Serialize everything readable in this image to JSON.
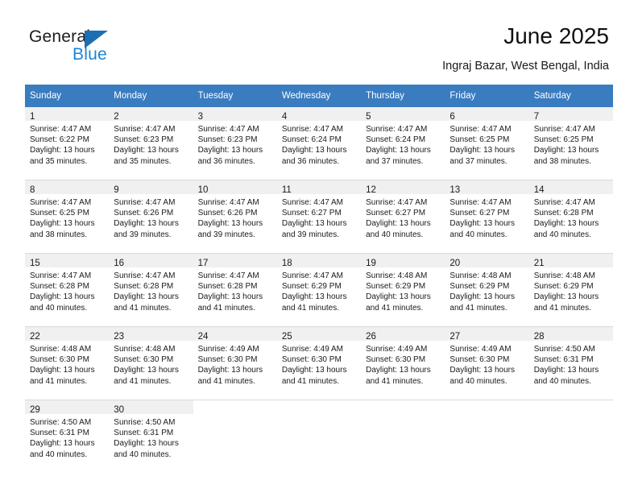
{
  "brand": {
    "name_part1": "General",
    "name_part2": "Blue",
    "flag_icon": "triangle-flag-icon"
  },
  "header": {
    "title": "June 2025",
    "location": "Ingraj Bazar, West Bengal, India"
  },
  "colors": {
    "header_blue": "#3a7cc0",
    "brand_blue": "#1c84d6",
    "daynum_band": "#f0f0f0",
    "row_divider": "#d9d9d9"
  },
  "weekdays": [
    "Sunday",
    "Monday",
    "Tuesday",
    "Wednesday",
    "Thursday",
    "Friday",
    "Saturday"
  ],
  "labels": {
    "sunrise_prefix": "Sunrise:",
    "sunset_prefix": "Sunset:",
    "daylight_prefix": "Daylight:"
  },
  "weeks": [
    [
      {
        "day": "1",
        "sunrise": "Sunrise: 4:47 AM",
        "sunset": "Sunset: 6:22 PM",
        "daylight1": "Daylight: 13 hours",
        "daylight2": "and 35 minutes."
      },
      {
        "day": "2",
        "sunrise": "Sunrise: 4:47 AM",
        "sunset": "Sunset: 6:23 PM",
        "daylight1": "Daylight: 13 hours",
        "daylight2": "and 35 minutes."
      },
      {
        "day": "3",
        "sunrise": "Sunrise: 4:47 AM",
        "sunset": "Sunset: 6:23 PM",
        "daylight1": "Daylight: 13 hours",
        "daylight2": "and 36 minutes."
      },
      {
        "day": "4",
        "sunrise": "Sunrise: 4:47 AM",
        "sunset": "Sunset: 6:24 PM",
        "daylight1": "Daylight: 13 hours",
        "daylight2": "and 36 minutes."
      },
      {
        "day": "5",
        "sunrise": "Sunrise: 4:47 AM",
        "sunset": "Sunset: 6:24 PM",
        "daylight1": "Daylight: 13 hours",
        "daylight2": "and 37 minutes."
      },
      {
        "day": "6",
        "sunrise": "Sunrise: 4:47 AM",
        "sunset": "Sunset: 6:25 PM",
        "daylight1": "Daylight: 13 hours",
        "daylight2": "and 37 minutes."
      },
      {
        "day": "7",
        "sunrise": "Sunrise: 4:47 AM",
        "sunset": "Sunset: 6:25 PM",
        "daylight1": "Daylight: 13 hours",
        "daylight2": "and 38 minutes."
      }
    ],
    [
      {
        "day": "8",
        "sunrise": "Sunrise: 4:47 AM",
        "sunset": "Sunset: 6:25 PM",
        "daylight1": "Daylight: 13 hours",
        "daylight2": "and 38 minutes."
      },
      {
        "day": "9",
        "sunrise": "Sunrise: 4:47 AM",
        "sunset": "Sunset: 6:26 PM",
        "daylight1": "Daylight: 13 hours",
        "daylight2": "and 39 minutes."
      },
      {
        "day": "10",
        "sunrise": "Sunrise: 4:47 AM",
        "sunset": "Sunset: 6:26 PM",
        "daylight1": "Daylight: 13 hours",
        "daylight2": "and 39 minutes."
      },
      {
        "day": "11",
        "sunrise": "Sunrise: 4:47 AM",
        "sunset": "Sunset: 6:27 PM",
        "daylight1": "Daylight: 13 hours",
        "daylight2": "and 39 minutes."
      },
      {
        "day": "12",
        "sunrise": "Sunrise: 4:47 AM",
        "sunset": "Sunset: 6:27 PM",
        "daylight1": "Daylight: 13 hours",
        "daylight2": "and 40 minutes."
      },
      {
        "day": "13",
        "sunrise": "Sunrise: 4:47 AM",
        "sunset": "Sunset: 6:27 PM",
        "daylight1": "Daylight: 13 hours",
        "daylight2": "and 40 minutes."
      },
      {
        "day": "14",
        "sunrise": "Sunrise: 4:47 AM",
        "sunset": "Sunset: 6:28 PM",
        "daylight1": "Daylight: 13 hours",
        "daylight2": "and 40 minutes."
      }
    ],
    [
      {
        "day": "15",
        "sunrise": "Sunrise: 4:47 AM",
        "sunset": "Sunset: 6:28 PM",
        "daylight1": "Daylight: 13 hours",
        "daylight2": "and 40 minutes."
      },
      {
        "day": "16",
        "sunrise": "Sunrise: 4:47 AM",
        "sunset": "Sunset: 6:28 PM",
        "daylight1": "Daylight: 13 hours",
        "daylight2": "and 41 minutes."
      },
      {
        "day": "17",
        "sunrise": "Sunrise: 4:47 AM",
        "sunset": "Sunset: 6:28 PM",
        "daylight1": "Daylight: 13 hours",
        "daylight2": "and 41 minutes."
      },
      {
        "day": "18",
        "sunrise": "Sunrise: 4:47 AM",
        "sunset": "Sunset: 6:29 PM",
        "daylight1": "Daylight: 13 hours",
        "daylight2": "and 41 minutes."
      },
      {
        "day": "19",
        "sunrise": "Sunrise: 4:48 AM",
        "sunset": "Sunset: 6:29 PM",
        "daylight1": "Daylight: 13 hours",
        "daylight2": "and 41 minutes."
      },
      {
        "day": "20",
        "sunrise": "Sunrise: 4:48 AM",
        "sunset": "Sunset: 6:29 PM",
        "daylight1": "Daylight: 13 hours",
        "daylight2": "and 41 minutes."
      },
      {
        "day": "21",
        "sunrise": "Sunrise: 4:48 AM",
        "sunset": "Sunset: 6:29 PM",
        "daylight1": "Daylight: 13 hours",
        "daylight2": "and 41 minutes."
      }
    ],
    [
      {
        "day": "22",
        "sunrise": "Sunrise: 4:48 AM",
        "sunset": "Sunset: 6:30 PM",
        "daylight1": "Daylight: 13 hours",
        "daylight2": "and 41 minutes."
      },
      {
        "day": "23",
        "sunrise": "Sunrise: 4:48 AM",
        "sunset": "Sunset: 6:30 PM",
        "daylight1": "Daylight: 13 hours",
        "daylight2": "and 41 minutes."
      },
      {
        "day": "24",
        "sunrise": "Sunrise: 4:49 AM",
        "sunset": "Sunset: 6:30 PM",
        "daylight1": "Daylight: 13 hours",
        "daylight2": "and 41 minutes."
      },
      {
        "day": "25",
        "sunrise": "Sunrise: 4:49 AM",
        "sunset": "Sunset: 6:30 PM",
        "daylight1": "Daylight: 13 hours",
        "daylight2": "and 41 minutes."
      },
      {
        "day": "26",
        "sunrise": "Sunrise: 4:49 AM",
        "sunset": "Sunset: 6:30 PM",
        "daylight1": "Daylight: 13 hours",
        "daylight2": "and 41 minutes."
      },
      {
        "day": "27",
        "sunrise": "Sunrise: 4:49 AM",
        "sunset": "Sunset: 6:30 PM",
        "daylight1": "Daylight: 13 hours",
        "daylight2": "and 40 minutes."
      },
      {
        "day": "28",
        "sunrise": "Sunrise: 4:50 AM",
        "sunset": "Sunset: 6:31 PM",
        "daylight1": "Daylight: 13 hours",
        "daylight2": "and 40 minutes."
      }
    ],
    [
      {
        "day": "29",
        "sunrise": "Sunrise: 4:50 AM",
        "sunset": "Sunset: 6:31 PM",
        "daylight1": "Daylight: 13 hours",
        "daylight2": "and 40 minutes."
      },
      {
        "day": "30",
        "sunrise": "Sunrise: 4:50 AM",
        "sunset": "Sunset: 6:31 PM",
        "daylight1": "Daylight: 13 hours",
        "daylight2": "and 40 minutes."
      },
      {
        "day": "",
        "sunrise": "",
        "sunset": "",
        "daylight1": "",
        "daylight2": ""
      },
      {
        "day": "",
        "sunrise": "",
        "sunset": "",
        "daylight1": "",
        "daylight2": ""
      },
      {
        "day": "",
        "sunrise": "",
        "sunset": "",
        "daylight1": "",
        "daylight2": ""
      },
      {
        "day": "",
        "sunrise": "",
        "sunset": "",
        "daylight1": "",
        "daylight2": ""
      },
      {
        "day": "",
        "sunrise": "",
        "sunset": "",
        "daylight1": "",
        "daylight2": ""
      }
    ]
  ]
}
